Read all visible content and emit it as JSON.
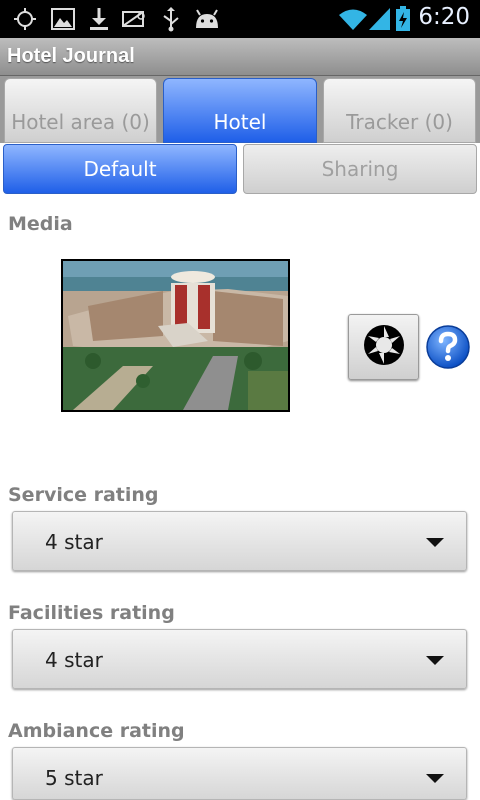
{
  "status_bar": {
    "time": "6:20",
    "icons": [
      "gps-icon",
      "gallery-icon",
      "download-icon",
      "no-sim-icon",
      "usb-icon",
      "android-debug-icon",
      "wifi-icon",
      "signal-icon",
      "battery-charging-icon"
    ]
  },
  "app": {
    "title": "Hotel Journal"
  },
  "tabs": [
    {
      "label": "Hotel area (0)",
      "active": false
    },
    {
      "label": "Hotel",
      "active": true
    },
    {
      "label": "Tracker (0)",
      "active": false
    }
  ],
  "subtabs": [
    {
      "label": "Default",
      "active": true
    },
    {
      "label": "Sharing",
      "active": false
    }
  ],
  "media": {
    "label": "Media",
    "camera_icon": "camera-aperture-icon",
    "help_icon": "help-icon"
  },
  "ratings": [
    {
      "label": "Service rating",
      "value": "4 star"
    },
    {
      "label": "Facilities rating",
      "value": "4 star"
    },
    {
      "label": "Ambiance rating",
      "value": "5 star"
    }
  ],
  "colors": {
    "tab_active": "#1f5fe8",
    "label_gray": "#808080"
  }
}
